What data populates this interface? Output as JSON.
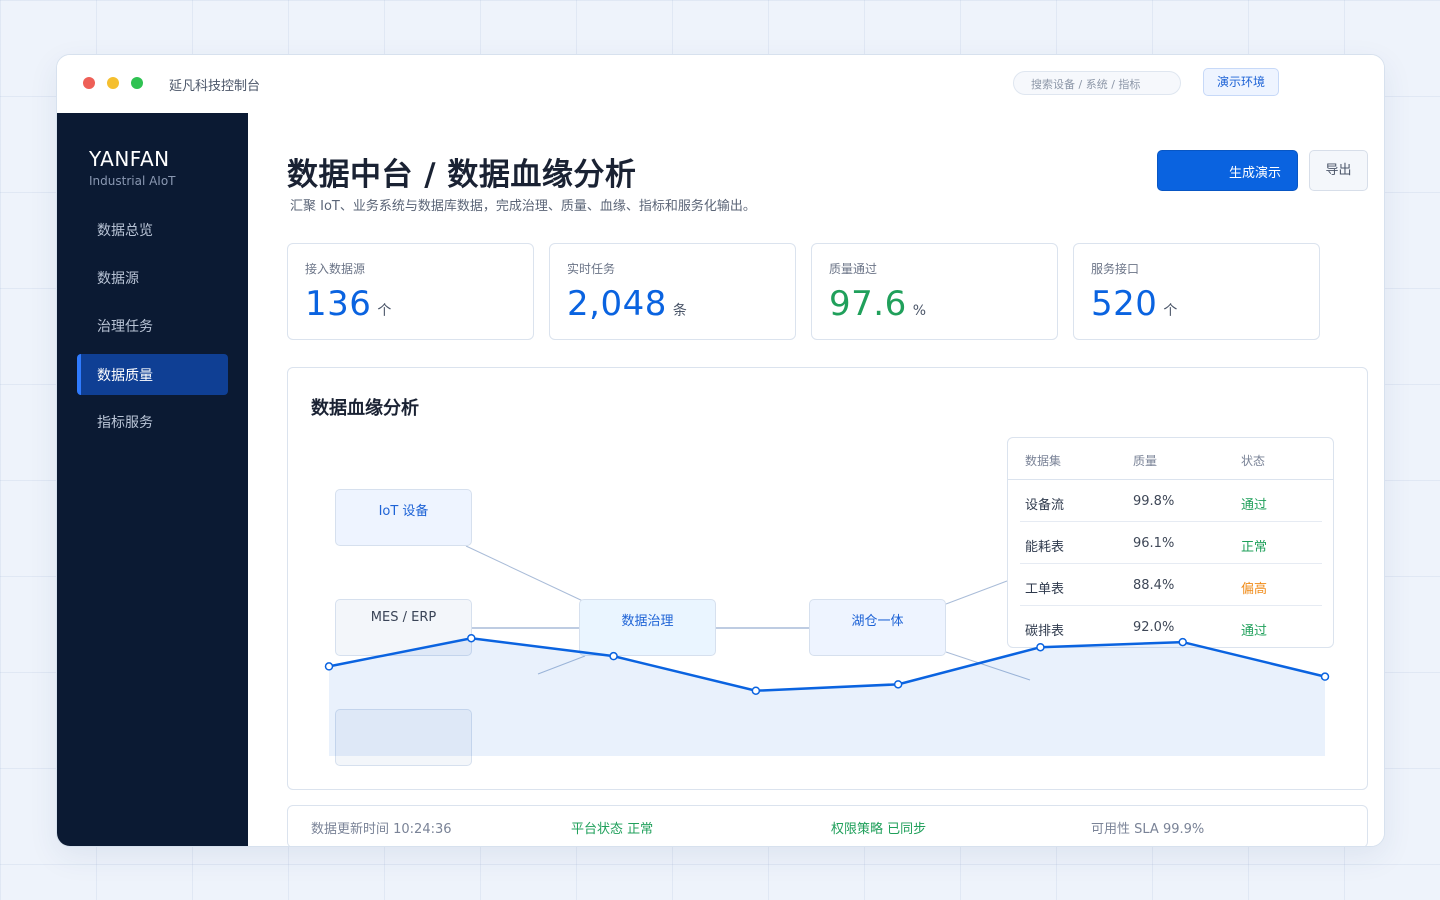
{
  "window": {
    "app_title": "延凡科技控制台",
    "search_placeholder": "搜索设备 / 系统 / 指标",
    "env_badge": "演示环境"
  },
  "sidebar": {
    "brand": "YANFAN",
    "brand_sub": "Industrial AIoT",
    "items": [
      {
        "label": "数据总览",
        "active": false
      },
      {
        "label": "数据源",
        "active": false
      },
      {
        "label": "治理任务",
        "active": false
      },
      {
        "label": "数据质量",
        "active": true
      },
      {
        "label": "指标服务",
        "active": false
      }
    ]
  },
  "header": {
    "title": "数据中台 / 数据血缘分析",
    "subtitle": "汇聚 IoT、业务系统与数据库数据，完成治理、质量、血缘、指标和服务化输出。",
    "primary_button": "生成演示",
    "secondary_button": "导出"
  },
  "kpis": [
    {
      "label": "接入数据源",
      "value": "136",
      "unit": "个",
      "color": "#0a63e0"
    },
    {
      "label": "实时任务",
      "value": "2,048",
      "unit": "条",
      "color": "#0a63e0"
    },
    {
      "label": "质量通过",
      "value": "97.6",
      "unit": "%",
      "color": "#20a05b"
    },
    {
      "label": "服务接口",
      "value": "520",
      "unit": "个",
      "color": "#0a63e0"
    }
  ],
  "lineage": {
    "title": "数据血缘分析",
    "nodes": {
      "iot": "IoT 设备",
      "mes": "MES / ERP",
      "governance": "数据治理",
      "lakehouse": "湖仓一体"
    },
    "table": {
      "headers": [
        "数据集",
        "质量",
        "状态"
      ],
      "rows": [
        {
          "name": "设备流",
          "quality": "99.8%",
          "status": "通过",
          "level": "ok"
        },
        {
          "name": "能耗表",
          "quality": "96.1%",
          "status": "正常",
          "level": "ok"
        },
        {
          "name": "工单表",
          "quality": "88.4%",
          "status": "偏高",
          "level": "warn"
        },
        {
          "name": "碳排表",
          "quality": "92.0%",
          "status": "通过",
          "level": "ok"
        }
      ]
    },
    "trend": [
      0.7,
      0.92,
      0.78,
      0.51,
      0.56,
      0.85,
      0.89,
      0.62
    ]
  },
  "status_bar": {
    "update_time": "数据更新时间 10:24:36",
    "platform": "平台状态 正常",
    "policy": "权限策略 已同步",
    "sla": "可用性 SLA 99.9%"
  },
  "colors": {
    "accent": "#0a63e0",
    "sidebar_bg": "#0b1a33",
    "ok": "#20a05b",
    "warn": "#f08c1a"
  }
}
